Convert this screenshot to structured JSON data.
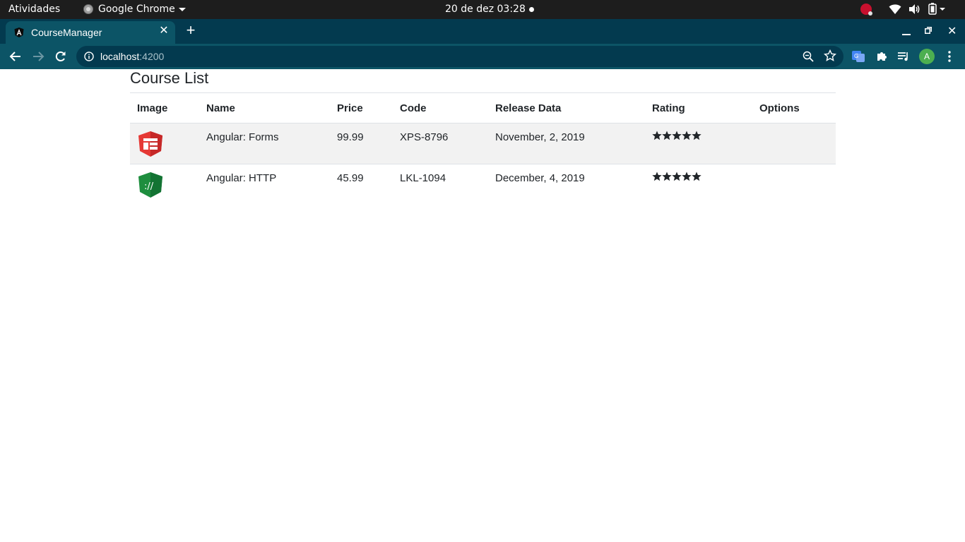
{
  "system_bar": {
    "activities": "Atividades",
    "app_name": "Google Chrome",
    "clock": "20 de dez  03:28"
  },
  "browser": {
    "tab_title": "CourseManager",
    "url_host": "localhost",
    "url_port": ":4200",
    "profile_initial": "A"
  },
  "page": {
    "title": "Course List",
    "columns": [
      "Image",
      "Name",
      "Price",
      "Code",
      "Release Data",
      "Rating",
      "Options"
    ],
    "courses": [
      {
        "image_icon": "angular-forms-icon",
        "image_color": "#e53935",
        "name": "Angular: Forms",
        "price": "99.99",
        "code": "XPS-8796",
        "release_date": "November, 2, 2019",
        "rating": 5,
        "options": ""
      },
      {
        "image_icon": "angular-http-icon",
        "image_color": "#1e8e3e",
        "name": "Angular: HTTP",
        "price": "45.99",
        "code": "LKL-1094",
        "release_date": "December, 4, 2019",
        "rating": 5,
        "options": ""
      }
    ],
    "row_stripe_color": "#f2f2f2"
  }
}
